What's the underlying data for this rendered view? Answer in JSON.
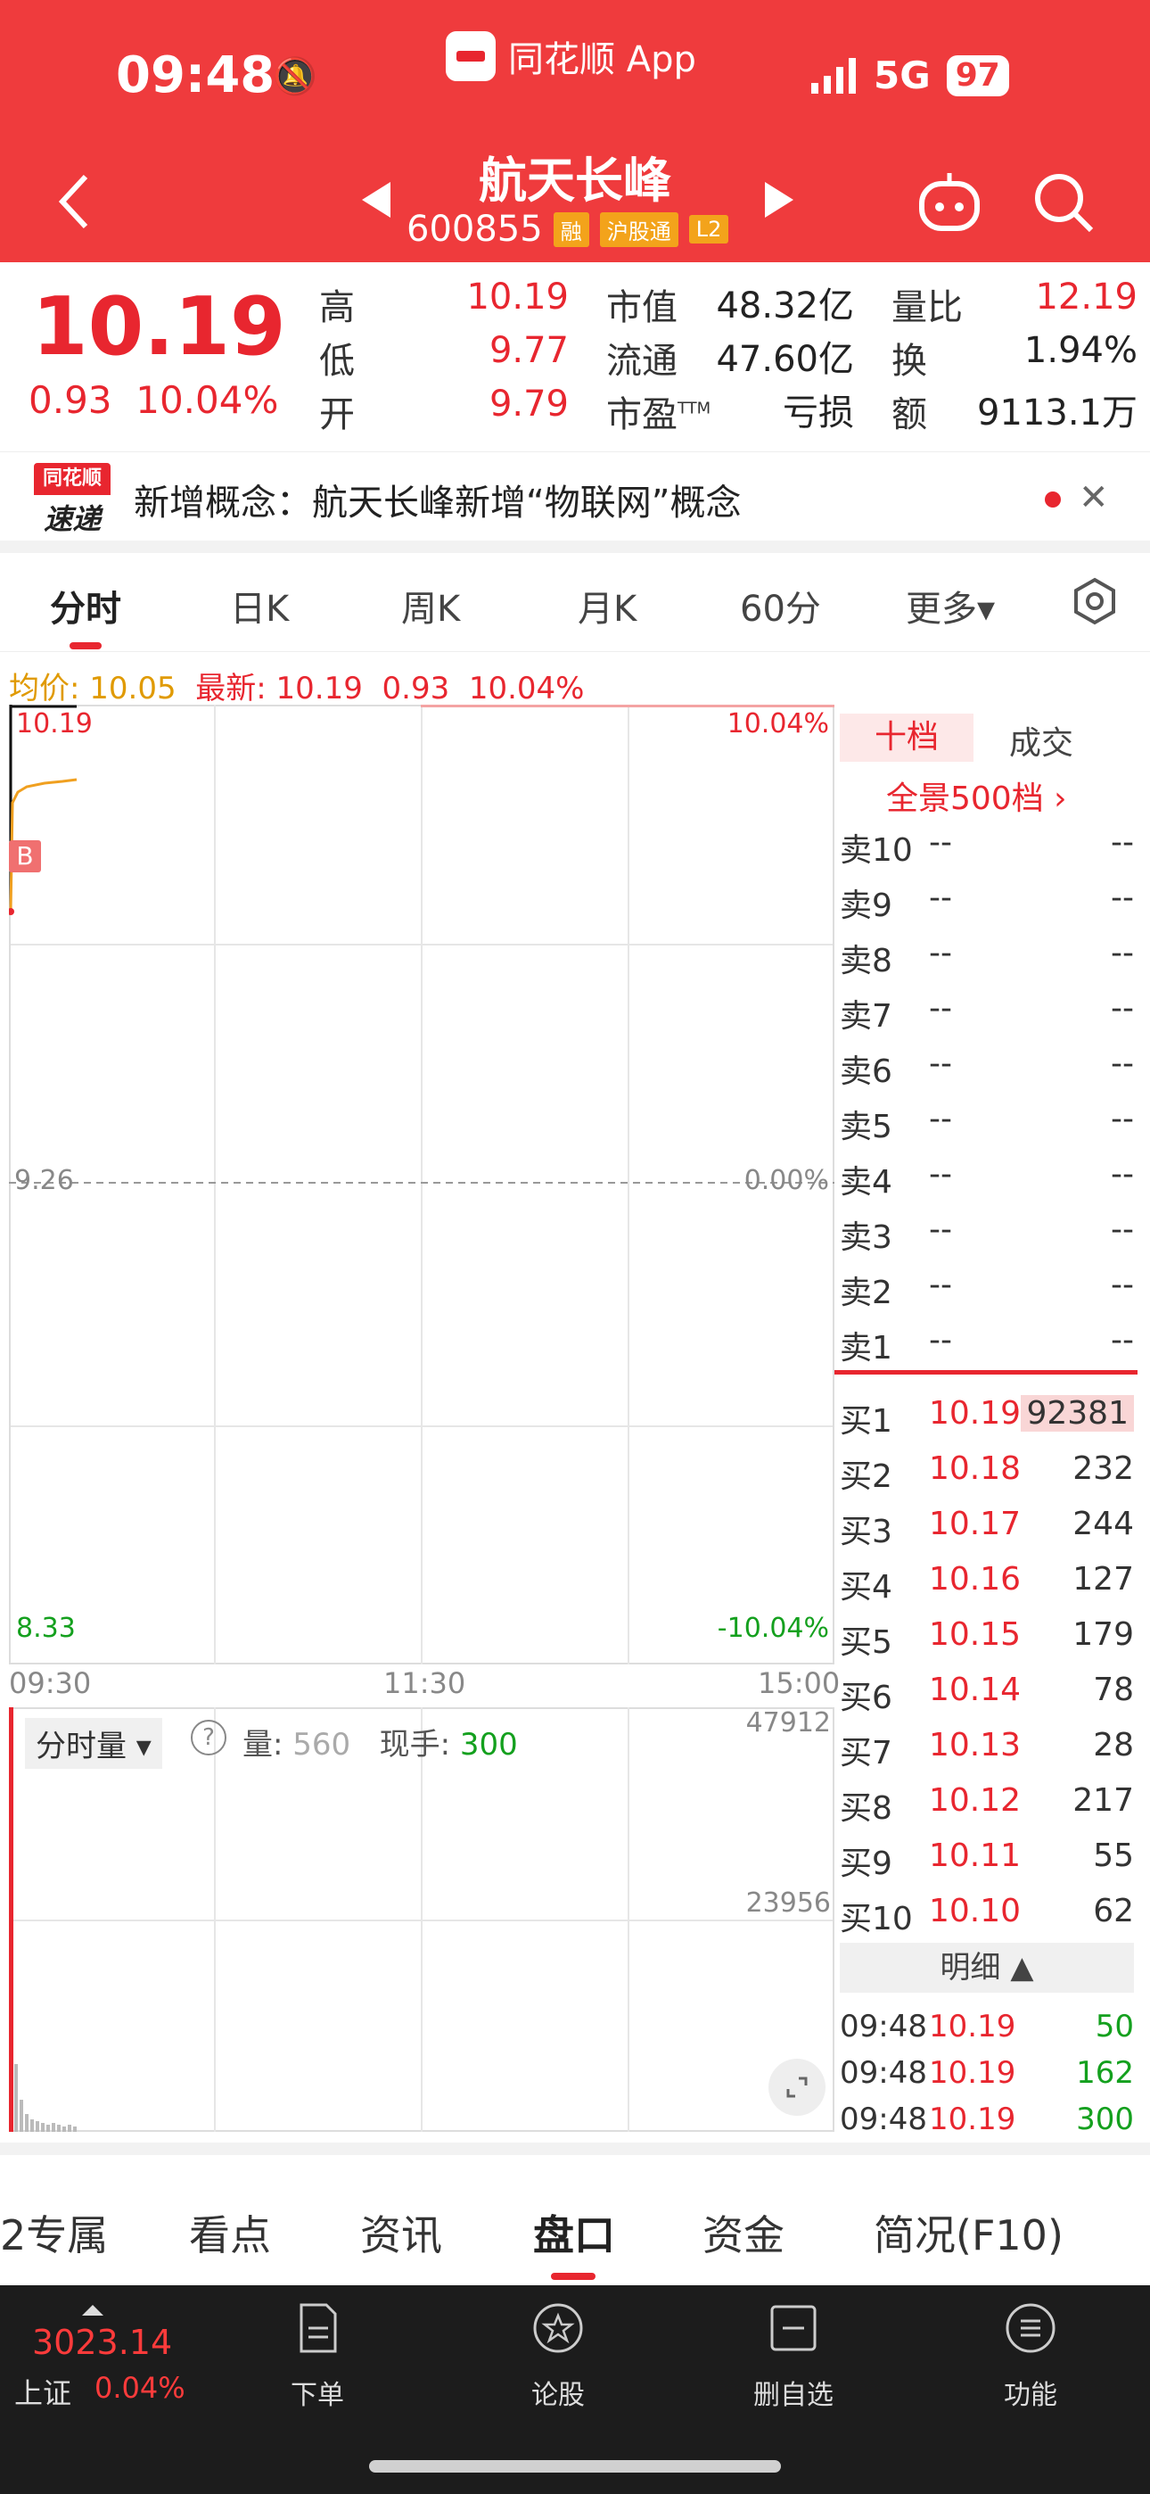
{
  "status": {
    "time": "09:48",
    "app": "同花顺 App",
    "network": "5G",
    "battery": "97"
  },
  "header": {
    "name": "航天长峰",
    "code": "600855",
    "tags": [
      "融",
      "沪股通",
      "L2"
    ]
  },
  "quote": {
    "price": "10.19",
    "change": "0.93",
    "change_pct": "10.04%",
    "stats": [
      {
        "label": "高",
        "value": "10.19",
        "color": "red"
      },
      {
        "label": "低",
        "value": "9.77",
        "color": "red"
      },
      {
        "label": "开",
        "value": "9.79",
        "color": "red"
      },
      {
        "label": "市值",
        "value": "48.32亿",
        "color": "black"
      },
      {
        "label": "流通",
        "value": "47.60亿",
        "color": "black"
      },
      {
        "label": "市盈",
        "sup": "TTM",
        "value": "亏损",
        "color": "black"
      },
      {
        "label": "量比",
        "value": "12.19",
        "color": "red"
      },
      {
        "label": "换",
        "value": "1.94%",
        "color": "black"
      },
      {
        "label": "额",
        "value": "9113.1万",
        "color": "black"
      }
    ]
  },
  "news": {
    "logo_top": "同花顺",
    "logo_bottom": "速递",
    "text": "新增概念：航天长峰新增“物联网”概念"
  },
  "tabs": [
    "分时",
    "日K",
    "周K",
    "月K",
    "60分",
    "更多▾"
  ],
  "infoline": {
    "avg_label": "均价:",
    "avg": "10.05",
    "last_label": "最新:",
    "last": "10.19",
    "chg": "0.93",
    "pct": "10.04%"
  },
  "chart": {
    "top_price": "10.19",
    "top_pct": "10.04%",
    "mid_price": "9.26",
    "mid_pct": "0.00%",
    "bot_price": "8.33",
    "bot_pct": "-10.04%",
    "times": [
      "09:30",
      "11:30",
      "15:00"
    ],
    "marker": "B",
    "volume_label": "分时量 ▾",
    "help": "?",
    "vol_label": "量:",
    "vol": "560",
    "hand_label": "现手:",
    "hand": "300",
    "vol_max": "47912",
    "vol_mid": "23956"
  },
  "book": {
    "tabs": [
      "十档",
      "成交"
    ],
    "panorama": "全景500档 ›",
    "asks": [
      {
        "label": "卖10",
        "price": "--",
        "vol": "--"
      },
      {
        "label": "卖9",
        "price": "--",
        "vol": "--"
      },
      {
        "label": "卖8",
        "price": "--",
        "vol": "--"
      },
      {
        "label": "卖7",
        "price": "--",
        "vol": "--"
      },
      {
        "label": "卖6",
        "price": "--",
        "vol": "--"
      },
      {
        "label": "卖5",
        "price": "--",
        "vol": "--"
      },
      {
        "label": "卖4",
        "price": "--",
        "vol": "--"
      },
      {
        "label": "卖3",
        "price": "--",
        "vol": "--"
      },
      {
        "label": "卖2",
        "price": "--",
        "vol": "--"
      },
      {
        "label": "卖1",
        "price": "--",
        "vol": "--"
      }
    ],
    "bids": [
      {
        "label": "买1",
        "price": "10.19",
        "vol": "92381"
      },
      {
        "label": "买2",
        "price": "10.18",
        "vol": "232"
      },
      {
        "label": "买3",
        "price": "10.17",
        "vol": "244"
      },
      {
        "label": "买4",
        "price": "10.16",
        "vol": "127"
      },
      {
        "label": "买5",
        "price": "10.15",
        "vol": "179"
      },
      {
        "label": "买6",
        "price": "10.14",
        "vol": "78"
      },
      {
        "label": "买7",
        "price": "10.13",
        "vol": "28"
      },
      {
        "label": "买8",
        "price": "10.12",
        "vol": "217"
      },
      {
        "label": "买9",
        "price": "10.11",
        "vol": "55"
      },
      {
        "label": "买10",
        "price": "10.10",
        "vol": "62"
      }
    ],
    "detail_label": "明细 ▲",
    "trades": [
      {
        "time": "09:48",
        "price": "10.19",
        "vol": "50"
      },
      {
        "time": "09:48",
        "price": "10.19",
        "vol": "162"
      },
      {
        "time": "09:48",
        "price": "10.19",
        "vol": "300"
      }
    ]
  },
  "bottom_tabs": [
    "2专属",
    "看点",
    "资讯",
    "盘口",
    "资金",
    "简况(F10)"
  ],
  "dock": {
    "index_value": "3023.14",
    "index_name": "上证",
    "index_pct": "0.04%",
    "items": [
      "下单",
      "论股",
      "删自选",
      "功能"
    ]
  }
}
